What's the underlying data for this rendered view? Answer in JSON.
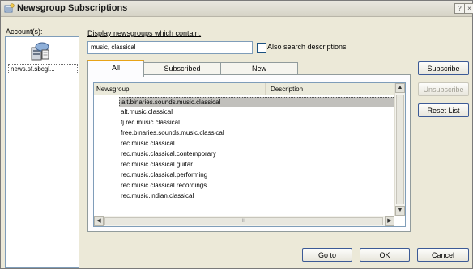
{
  "window": {
    "title": "Newsgroup Subscriptions",
    "help_button": "?",
    "close_button": "×"
  },
  "accounts": {
    "label": "Account(s):",
    "items": [
      "news.sf.sbcgl..."
    ]
  },
  "filter": {
    "label": "Display newsgroups which contain:",
    "value": "music, classical",
    "also_search_label": "Also search descriptions",
    "also_search_checked": false
  },
  "tabs": [
    {
      "label": "All",
      "active": true
    },
    {
      "label": "Subscribed",
      "active": false
    },
    {
      "label": "New",
      "active": false
    }
  ],
  "list": {
    "columns": [
      "Newsgroup",
      "Description"
    ],
    "rows": [
      "alt.binaries.sounds.music.classical",
      "alt.music.classical",
      "fj.rec.music.classical",
      "free.binaries.sounds.music.classical",
      "rec.music.classical",
      "rec.music.classical.contemporary",
      "rec.music.classical.guitar",
      "rec.music.classical.performing",
      "rec.music.classical.recordings",
      "rec.music.indian.classical"
    ],
    "selected_index": 0
  },
  "scroll": {
    "up_arrow": "▲",
    "down_arrow": "▼",
    "left_arrow": "◀",
    "right_arrow": "▶",
    "grip": "III"
  },
  "side_buttons": {
    "subscribe": "Subscribe",
    "unsubscribe": "Unsubscribe",
    "reset_list": "Reset List"
  },
  "footer_buttons": {
    "go_to": "Go to",
    "ok": "OK",
    "cancel": "Cancel"
  }
}
